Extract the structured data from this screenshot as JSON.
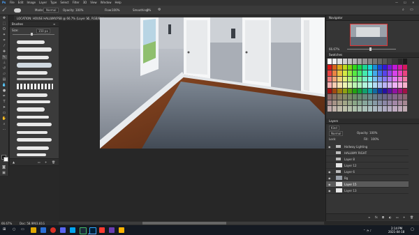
{
  "app": {
    "menu": [
      "File",
      "Edit",
      "Image",
      "Layer",
      "Type",
      "Select",
      "Filter",
      "3D",
      "View",
      "Window",
      "Help"
    ],
    "doc_tab": "LOCATION: HOUSE HALLWAY.PSB @ 66.7% (Layer 15, RGB/8) *"
  },
  "options": {
    "mode_label": "Mode:",
    "mode_value": "Normal",
    "opacity_label": "Opacity:",
    "opacity_value": "100%",
    "flow_label": "Flow:",
    "flow_value": "100%",
    "smoothing_label": "Smoothing:",
    "smoothing_value": "0%"
  },
  "brush_panel": {
    "title": "Brushes",
    "size_label": "Size:",
    "size_value": "150 px"
  },
  "navigator": {
    "title": "Navigator",
    "zoom": "66.67%"
  },
  "swatches": {
    "title": "Swatches"
  },
  "layers": {
    "title": "Layers",
    "kind_label": "Kind",
    "blend_mode": "Normal",
    "opacity_label": "Opacity:",
    "opacity_value": "100%",
    "fill_label": "Fill:",
    "fill_value": "100%",
    "lock_label": "Lock:",
    "rows": [
      {
        "name": "Hallway Lighting"
      },
      {
        "name": "HALLWAY RIGHT"
      },
      {
        "name": "Layer 8"
      },
      {
        "name": "Layer 12"
      },
      {
        "name": "Layer 6"
      },
      {
        "name": "Bg"
      },
      {
        "name": "Layer 15"
      },
      {
        "name": "Layer 13"
      }
    ]
  },
  "status": {
    "zoom": "66.67%",
    "doc": "Doc: 58.9M/3.81G"
  },
  "taskbar": {
    "time": "2:14 PM",
    "date": "2021-04-18"
  },
  "colors": {
    "wall": "#8d949e",
    "floor_wood": "#7a3b1c",
    "rug": "#5d6672",
    "accent": "#2f7bd6"
  }
}
